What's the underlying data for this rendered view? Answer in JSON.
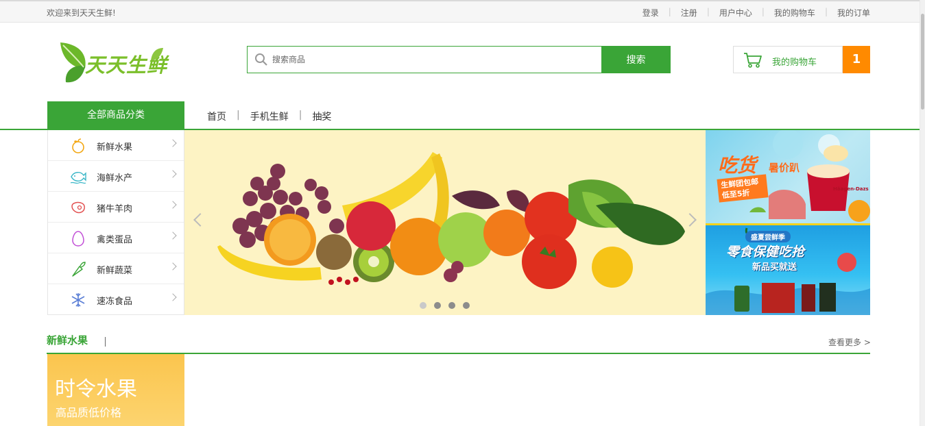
{
  "topbar": {
    "welcome": "欢迎来到天天生鲜!",
    "links": [
      "登录",
      "注册",
      "用户中心",
      "我的购物车",
      "我的订单"
    ]
  },
  "header": {
    "logo_text": "天天生鲜",
    "search_placeholder": "搜索商品",
    "search_button": "搜索",
    "cart_label": "我的购物车",
    "cart_count": "1"
  },
  "nav": {
    "all_categories": "全部商品分类",
    "links": [
      "首页",
      "手机生鲜",
      "抽奖"
    ]
  },
  "categories": [
    {
      "label": "新鲜水果",
      "icon": "fruit-icon"
    },
    {
      "label": "海鲜水产",
      "icon": "seafood-icon"
    },
    {
      "label": "猪牛羊肉",
      "icon": "meat-icon"
    },
    {
      "label": "禽类蛋品",
      "icon": "egg-icon"
    },
    {
      "label": "新鲜蔬菜",
      "icon": "vegetable-icon"
    },
    {
      "label": "速冻食品",
      "icon": "frozen-icon"
    }
  ],
  "banner": {
    "slides": 4,
    "active_slide": 1
  },
  "ads": {
    "ad1_title": "吃货",
    "ad1_subtitle": "暑价趴",
    "ad1_tag": "生鲜团包邮 低至5折",
    "ad1_brand": "Häagen-Dazs",
    "ad2_badge": "盛夏尝鲜季",
    "ad2_title": "零食保健吃抢",
    "ad2_subtitle": "新品买就送"
  },
  "section": {
    "title": "新鲜水果",
    "more": "查看更多 >",
    "promo_title": "时令水果",
    "promo_subtitle": "高品质低价格"
  },
  "colors": {
    "brand_green": "#3aa537",
    "cart_orange": "#ff8a00",
    "banner_bg": "#fdf3c4",
    "promo_yellow": "#fbc54e"
  }
}
